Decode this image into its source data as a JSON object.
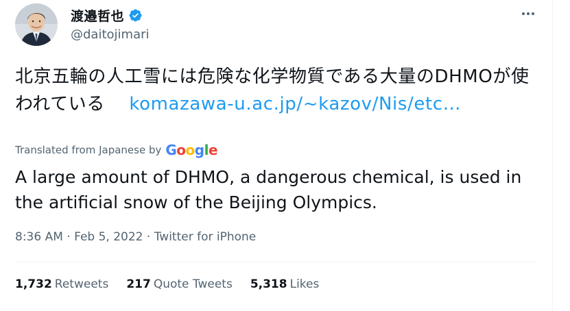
{
  "author": {
    "display_name": "渡邉哲也",
    "handle": "@daitojimari",
    "verified": true
  },
  "colors": {
    "link": "#1d9bf0",
    "verified": "#1d9bf0",
    "secondary": "#536471"
  },
  "tweet": {
    "original_text": "北京五輪の人工雪には危険な化学物質である大量のDHMOが使われている",
    "link_text": "komazawa-u.ac.jp/~kazov/Nis/etc…",
    "translated_label": "Translated from Japanese by",
    "translator": "Google",
    "translation": "A large amount of DHMO, a dangerous chemical, is used in the artificial snow of the Beijing Olympics."
  },
  "meta": {
    "time": "8:36 AM",
    "date": "Feb 5, 2022",
    "source": "Twitter for iPhone",
    "separator": " · "
  },
  "stats": {
    "retweets_count": "1,732",
    "retweets_label": "Retweets",
    "quotes_count": "217",
    "quotes_label": "Quote Tweets",
    "likes_count": "5,318",
    "likes_label": "Likes"
  },
  "icons": {
    "more": "more-horizontal-icon",
    "verified": "verified-badge-icon"
  }
}
